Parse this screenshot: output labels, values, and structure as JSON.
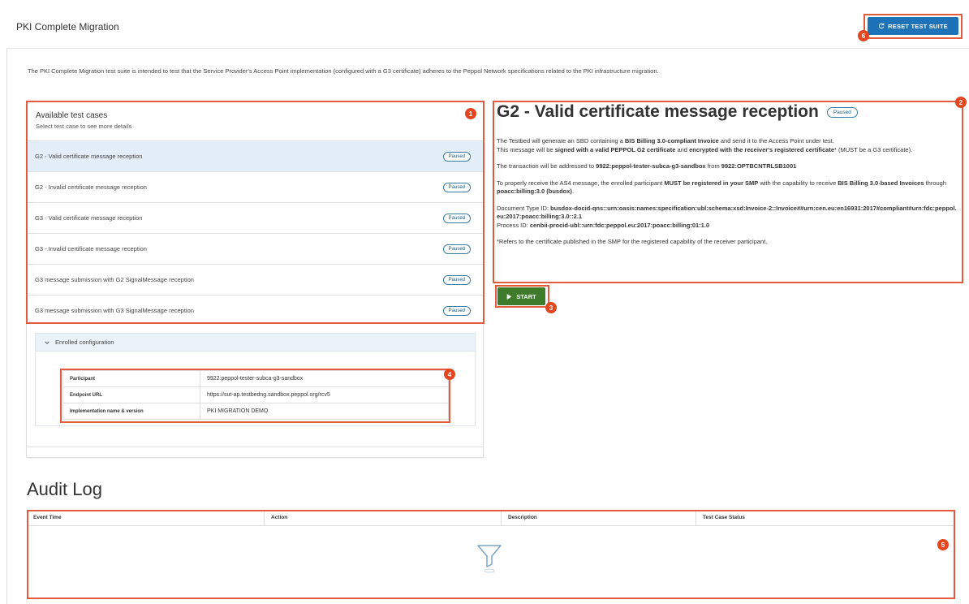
{
  "header": {
    "title": "PKI Complete Migration",
    "reset_label": "RESET TEST SUITE"
  },
  "intro": "The PKI Complete Migration test suite is intended to test that the Service Provider's Access Point implementation (configured with a G3 certificate) adheres to the Peppol Network specifications related to the PKI infrastructure migration.",
  "test_cases": {
    "title": "Available test cases",
    "subtitle": "Select test case to see more details",
    "items": [
      {
        "label": "G2 - Valid certificate message reception",
        "status": "Paused"
      },
      {
        "label": "G2 - Invalid certificate message reception",
        "status": "Paused"
      },
      {
        "label": "G3 - Valid certificate message reception",
        "status": "Paused"
      },
      {
        "label": "G3 - Invalid certificate message reception",
        "status": "Paused"
      },
      {
        "label": "G3 message submission with G2 SignalMessage reception",
        "status": "Paused"
      },
      {
        "label": "G3 message submission with G3 SignalMessage reception",
        "status": "Paused"
      }
    ]
  },
  "enrolled": {
    "title": "Enrolled configuration",
    "rows": [
      {
        "key": "Participant",
        "value": "9922:peppol-tester-subca-g3-sandbox"
      },
      {
        "key": "Endpoint URL",
        "value": "https://sut-ap.testbedng.sandbox.peppol.org/rcv5"
      },
      {
        "key": "Implementation name & version",
        "value": "PKI MIGRATION DEMO"
      }
    ]
  },
  "detail": {
    "title": "G2 - Valid certificate message reception",
    "status": "Paused",
    "p1a": "The Testbed will generate an SBD containing a ",
    "p1b": "BIS Billing 3.0-compliant Invoice",
    "p1c": " and send it to the Access Point under test.",
    "p1d": "This message will be ",
    "p1e": "signed with a valid PEPPOL G2 certificate",
    "p1f": " and ",
    "p1g": "encrypted with the receiver's registered certificate",
    "p1h": "* (MUST be a G3 certificate).",
    "p2a": "The transaction will be addressed to ",
    "p2b": "9922:peppol-tester-subca-g3-sandbox",
    "p2c": " from ",
    "p2d": "9922:OPTBCNTRLSB1001",
    "p3a": "To properly receive the AS4 message, the enrolled participant ",
    "p3b": "MUST be registered in your SMP",
    "p3c": " with the capability to receive ",
    "p3d": "BIS Billing 3.0-based Invoices",
    "p3e": " through ",
    "p3f": "poacc:billing:3.0 (busdox)",
    "p3g": ".",
    "p4a": "Document Type ID: ",
    "p4b": "busdox-docid-qns::urn:oasis:names:specification:ubl:schema:xsd:Invoice-2::Invoice##urn:cen.eu:en16931:2017#compliant#urn:fdc:peppol.eu:2017:poacc:billing:3.0::2.1",
    "p4c": "Process ID: ",
    "p4d": "cenbii-procid-ubl::urn:fdc:peppol.eu:2017:poacc:billing:01:1.0",
    "footnote": "*Refers to the certificate published in the SMP for the registered capability of the receiver participant.",
    "start_label": "START"
  },
  "audit": {
    "title": "Audit Log",
    "columns": [
      "Event Time",
      "Action",
      "Description",
      "Test Case Status"
    ]
  },
  "callouts": [
    "1",
    "2",
    "3",
    "4",
    "5",
    "6"
  ],
  "colors": {
    "primary": "#1e73b8",
    "start": "#3e7b2a",
    "callout": "#e4461f",
    "selected_row": "#e3eef8"
  }
}
